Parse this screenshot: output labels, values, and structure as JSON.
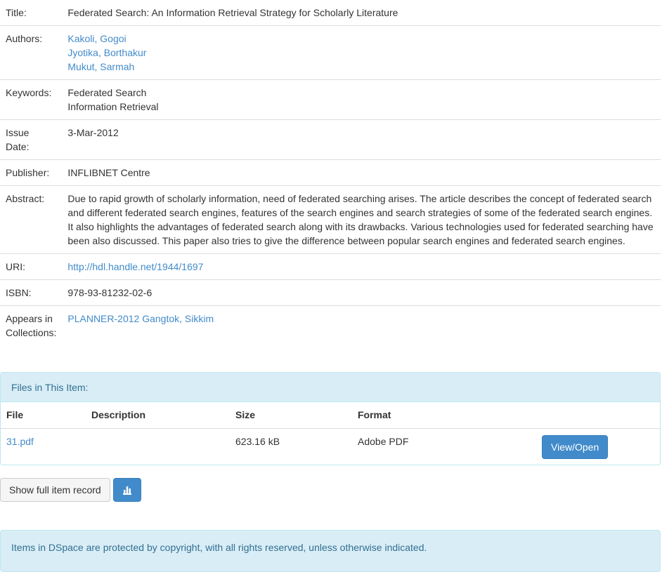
{
  "metadata": {
    "title_label": "Title:",
    "title_value": "Federated Search: An Information Retrieval Strategy for Scholarly Literature",
    "authors_label": "Authors:",
    "authors": [
      "Kakoli, Gogoi",
      "Jyotika, Borthakur",
      "Mukut, Sarmah"
    ],
    "keywords_label": "Keywords:",
    "keywords": [
      "Federated Search",
      "Information Retrieval"
    ],
    "issue_date_label_1": "Issue",
    "issue_date_label_2": "Date:",
    "issue_date_value": "3-Mar-2012",
    "publisher_label": "Publisher:",
    "publisher_value": "INFLIBNET Centre",
    "abstract_label": "Abstract:",
    "abstract_value": "Due to rapid growth of scholarly information, need of federated searching arises. The article describes the concept of federated search and different federated search engines, features of the search engines and search strategies of some of the federated search engines. It also highlights the advantages of federated search along with its drawbacks. Various technologies used for federated searching have been also discussed. This paper also tries to give the difference between popular search engines and federated search engines.",
    "uri_label": "URI:",
    "uri_value": "http://hdl.handle.net/1944/1697",
    "isbn_label": "ISBN:",
    "isbn_value": "978-93-81232-02-6",
    "collections_label_1": "Appears in",
    "collections_label_2": "Collections:",
    "collections_value": "PLANNER-2012 Gangtok, Sikkim"
  },
  "files": {
    "heading": "Files in This Item:",
    "columns": [
      "File",
      "Description",
      "Size",
      "Format"
    ],
    "rows": [
      {
        "file": "31.pdf",
        "description": "",
        "size": "623.16 kB",
        "format": "Adobe PDF",
        "action": "View/Open"
      }
    ]
  },
  "actions": {
    "full_record_label": "Show full item record",
    "stats_icon": "bar-chart-icon"
  },
  "footer": {
    "text": "Items in DSpace are protected by copyright, with all rights reserved, unless otherwise indicated."
  },
  "colors": {
    "link": "#428bca",
    "primary": "#428bca",
    "info_bg": "#d9edf7",
    "info_text": "#31708f"
  }
}
